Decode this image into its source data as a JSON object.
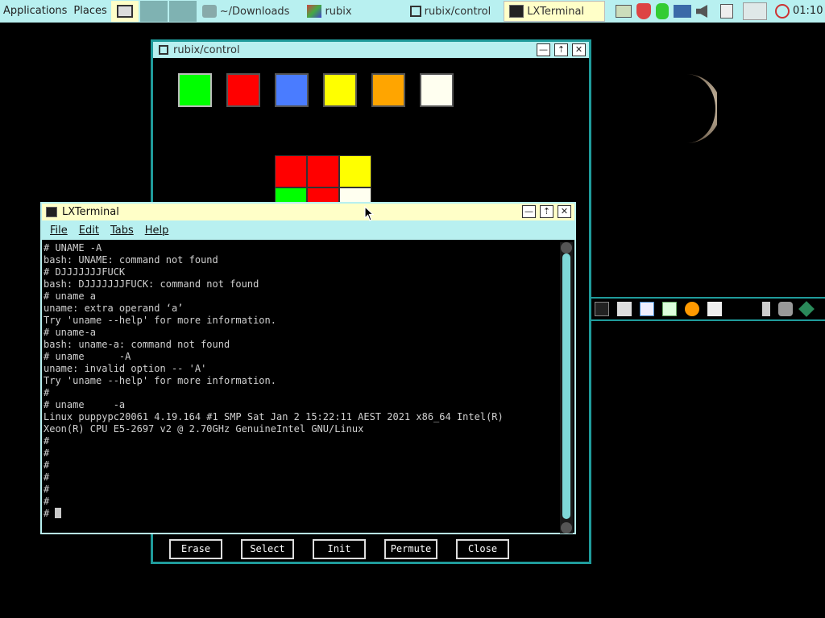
{
  "taskbar": {
    "applications": "Applications",
    "places": "Places",
    "tasks": [
      {
        "label": "~/Downloads"
      },
      {
        "label": "rubix"
      },
      {
        "label": "rubix/control"
      },
      {
        "label": "LXTerminal"
      }
    ],
    "clock": "01:10"
  },
  "rubix_window": {
    "title": "rubix/control",
    "buttons": [
      "Erase",
      "Select",
      "Init",
      "Permute",
      "Close"
    ],
    "palette": [
      "#00ff00",
      "#ff0000",
      "#4a7cff",
      "#ffff00",
      "#ffa500",
      "#fffff0"
    ],
    "cube_face": [
      "#ff0000",
      "#ff0000",
      "#ffff00",
      "#00ff00",
      "#ff0000",
      "#fffff0"
    ]
  },
  "terminal": {
    "title": "LXTerminal",
    "menu": [
      "File",
      "Edit",
      "Tabs",
      "Help"
    ],
    "lines": [
      "# UNAME -A",
      "bash: UNAME: command not found",
      "# DJJJJJJJFUCK",
      "bash: DJJJJJJJFUCK: command not found",
      "# uname a",
      "uname: extra operand ‘a’",
      "Try 'uname --help' for more information.",
      "# uname-a",
      "bash: uname-a: command not found",
      "# uname      -A",
      "uname: invalid option -- 'A'",
      "Try 'uname --help' for more information.",
      "#",
      "# uname     -a",
      "Linux puppypc20061 4.19.164 #1 SMP Sat Jan 2 15:22:11 AEST 2021 x86_64 Intel(R)",
      "Xeon(R) CPU E5-2697 v2 @ 2.70GHz GenuineIntel GNU/Linux",
      "#",
      "#",
      "#",
      "#",
      "#",
      "#"
    ],
    "prompt": "# "
  }
}
